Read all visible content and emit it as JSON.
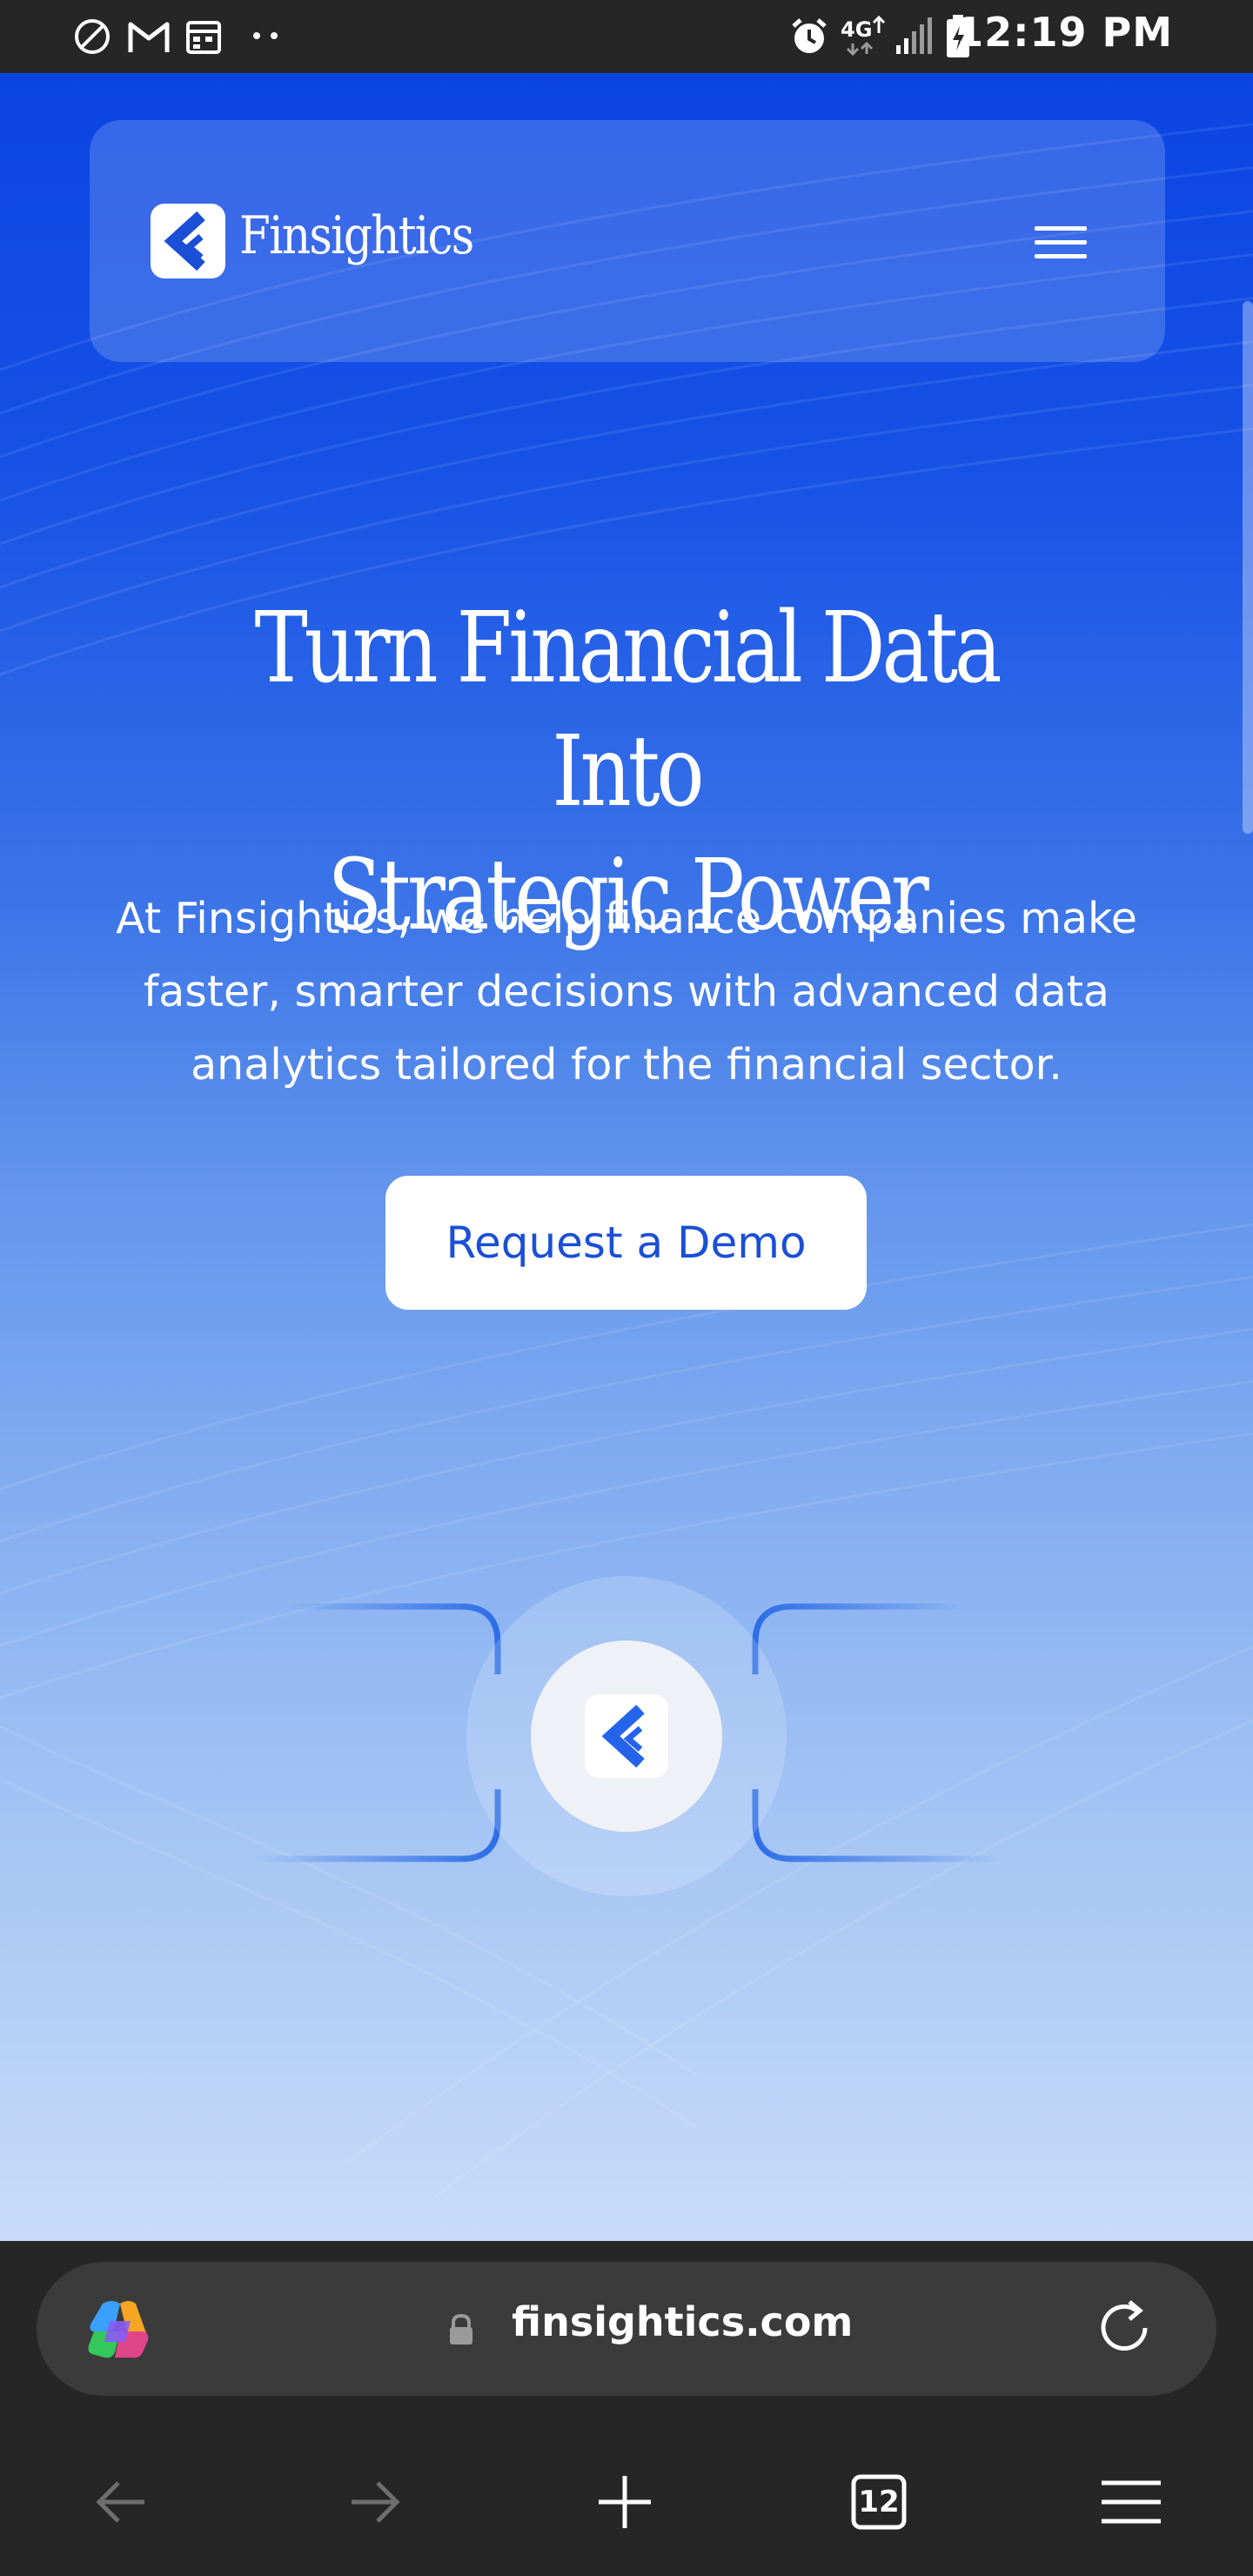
{
  "status_bar": {
    "time": "12:19 PM",
    "network": "4G",
    "icons": [
      "do-not-disturb-icon",
      "gmail-icon",
      "calendar-icon",
      "more-dots-icon",
      "alarm-icon",
      "network-4g-icon",
      "signal-icon",
      "battery-icon"
    ]
  },
  "site": {
    "brand": "Finsightics",
    "menu_icon": "hamburger-icon",
    "hero": {
      "title_line1": "Turn Financial Data Into",
      "title_line2": "Strategic Power",
      "subtitle_line1": "At Finsightics, we help finance companies make",
      "subtitle_line2": "faster, smarter decisions with advanced data",
      "subtitle_line3": "analytics tailored for the financial sector.",
      "cta_label": "Request a Demo"
    }
  },
  "browser": {
    "url": "finsightics.com",
    "tab_count": "12",
    "nav_icons": [
      "back-arrow-icon",
      "forward-arrow-icon",
      "new-tab-icon",
      "tab-switcher-icon",
      "browser-menu-icon"
    ]
  },
  "colors": {
    "brand_blue": "#1a4fd6",
    "hero_top": "#0a45e4",
    "hero_bottom": "#c8dcf8",
    "chrome_bg": "#262626",
    "address_bar_bg": "#3b3b3b"
  }
}
